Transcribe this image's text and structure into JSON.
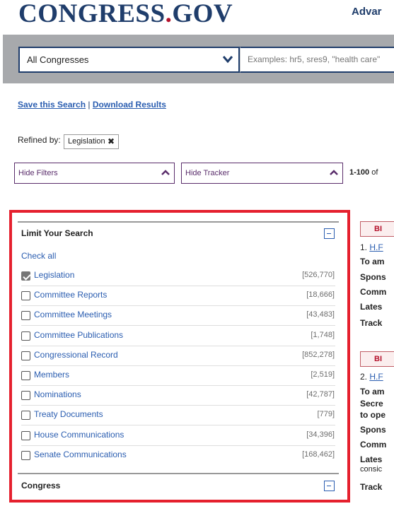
{
  "header": {
    "logo_main": "CONGRESS",
    "logo_dot": ".",
    "logo_tld": "GOV",
    "advanced": "Advar"
  },
  "search": {
    "congress_select": "All Congresses",
    "placeholder": "Examples: hr5, sres9, \"health care\""
  },
  "actions": {
    "save_search": "Save this Search",
    "separator": "|",
    "download": "Download Results"
  },
  "refined": {
    "label": "Refined by:",
    "chip": "Legislation",
    "chip_remove": "✖"
  },
  "filters": {
    "hide_filters": "Hide Filters",
    "hide_tracker": "Hide Tracker",
    "count_bold": "1-100",
    "count_rest": " of"
  },
  "limit": {
    "title": "Limit Your Search",
    "check_all": "Check all",
    "items": [
      {
        "label": "Legislation",
        "count": "[526,770]",
        "checked": true
      },
      {
        "label": "Committee Reports",
        "count": "[18,666]",
        "checked": false
      },
      {
        "label": "Committee Meetings",
        "count": "[43,483]",
        "checked": false
      },
      {
        "label": "Committee Publications",
        "count": "[1,748]",
        "checked": false
      },
      {
        "label": "Congressional Record",
        "count": "[852,278]",
        "checked": false
      },
      {
        "label": "Members",
        "count": "[2,519]",
        "checked": false
      },
      {
        "label": "Nominations",
        "count": "[42,787]",
        "checked": false
      },
      {
        "label": "Treaty Documents",
        "count": "[779]",
        "checked": false
      },
      {
        "label": "House Communications",
        "count": "[34,396]",
        "checked": false
      },
      {
        "label": "Senate Communications",
        "count": "[168,462]",
        "checked": false
      }
    ]
  },
  "congress_section": {
    "title": "Congress"
  },
  "results": {
    "r1": {
      "badge": "BI",
      "num": "1. ",
      "link": "H.F",
      "lines": [
        "To am",
        "Spons",
        "Comm",
        "Lates",
        "Track"
      ]
    },
    "r2": {
      "badge": "BI",
      "num": "2. ",
      "link": "H.F",
      "lines": [
        "To am",
        "Secre",
        "to ope",
        "Spons",
        "Comm",
        "Lates",
        "consic",
        "Track"
      ]
    }
  },
  "colors": {
    "brand_blue": "#1f3d6b",
    "brand_red": "#b5122c",
    "link_blue": "#2a5db0",
    "filter_purple": "#5a2d6b",
    "highlight_red": "#e5202e"
  }
}
